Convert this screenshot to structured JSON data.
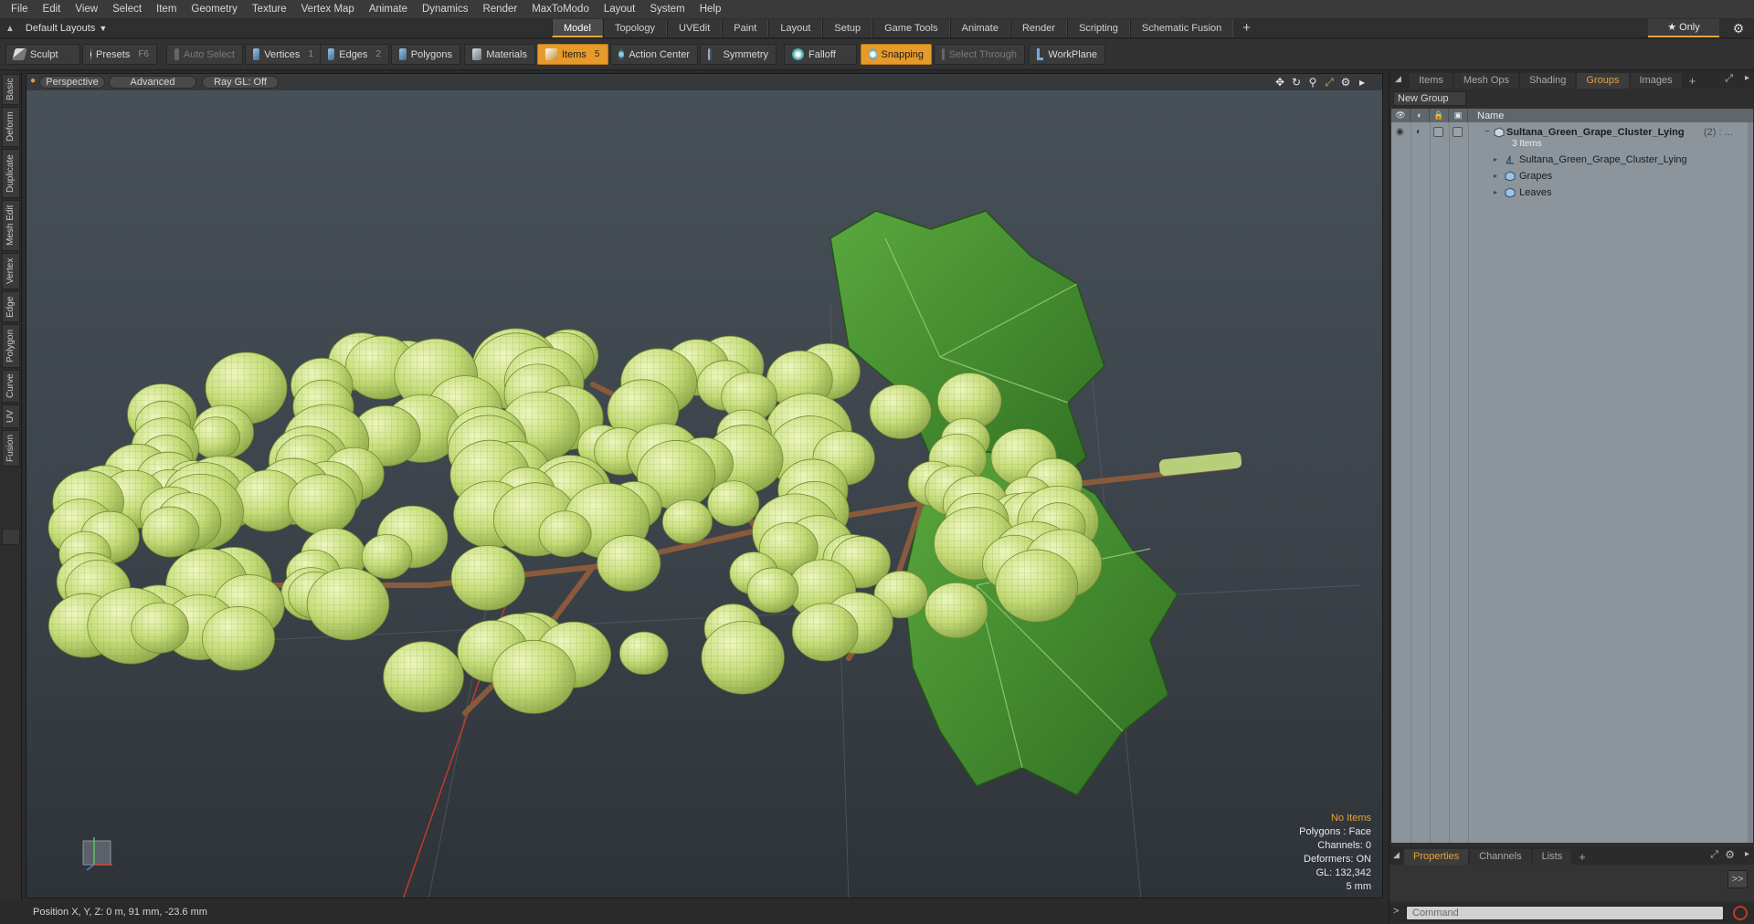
{
  "menu": [
    "File",
    "Edit",
    "View",
    "Select",
    "Item",
    "Geometry",
    "Texture",
    "Vertex Map",
    "Animate",
    "Dynamics",
    "Render",
    "MaxToModo",
    "Layout",
    "System",
    "Help"
  ],
  "layout": {
    "picker_label": "Default Layouts",
    "tabs": [
      "Model",
      "Topology",
      "UVEdit",
      "Paint",
      "Layout",
      "Setup",
      "Game Tools",
      "Animate",
      "Render",
      "Scripting",
      "Schematic Fusion"
    ],
    "active_tab": "Model",
    "plus": "+",
    "only_label": "★ Only"
  },
  "toolbar": {
    "sculpt": "Sculpt",
    "presets": "Presets",
    "presets_key": "F6",
    "auto_select": "Auto Select",
    "vertices": "Vertices",
    "vertices_count": "1",
    "edges": "Edges",
    "edges_count": "2",
    "polygons": "Polygons",
    "materials": "Materials",
    "items": "Items",
    "items_count": "5",
    "action_center": "Action Center",
    "symmetry": "Symmetry",
    "falloff": "Falloff",
    "snapping": "Snapping",
    "select_through": "Select Through",
    "workplane": "WorkPlane"
  },
  "left_tabs": [
    "Basic",
    "Deform",
    "Duplicate",
    "Mesh Edit",
    "Vertex",
    "Edge",
    "Polygon",
    "Curve",
    "UV",
    "Fusion"
  ],
  "viewport": {
    "view_mode": "Perspective",
    "shading": "Advanced",
    "raygl": "Ray GL: Off",
    "info": {
      "no_items": "No Items",
      "polygons": "Polygons : Face",
      "channels": "Channels: 0",
      "deformers": "Deformers: ON",
      "gl": "GL: 132,342",
      "scale": "5 mm"
    }
  },
  "status": {
    "position": "Position X, Y, Z:  0 m, 91 mm, -23.6 mm"
  },
  "right_panel": {
    "tabs": [
      "Items",
      "Mesh Ops",
      "Shading",
      "Groups",
      "Images"
    ],
    "active_tab": "Groups",
    "plus": "+",
    "new_group": "New Group",
    "name_header": "Name",
    "group": {
      "name": "Sultana_Green_Grape_Cluster_Lying",
      "suffix": "(2) : ...",
      "count": "3 Items",
      "children": [
        "Sultana_Green_Grape_Cluster_Lying",
        "Grapes",
        "Leaves"
      ]
    },
    "props_tabs": [
      "Properties",
      "Channels",
      "Lists"
    ],
    "props_active": "Properties",
    "props_arrow": ">>",
    "command_placeholder": "Command"
  },
  "colors": {
    "accent": "#e79a2a",
    "grape": "#c9de7a",
    "leaf": "#3f8a2d",
    "stem": "#8a5a3c",
    "table_bg": "#8c959c"
  }
}
